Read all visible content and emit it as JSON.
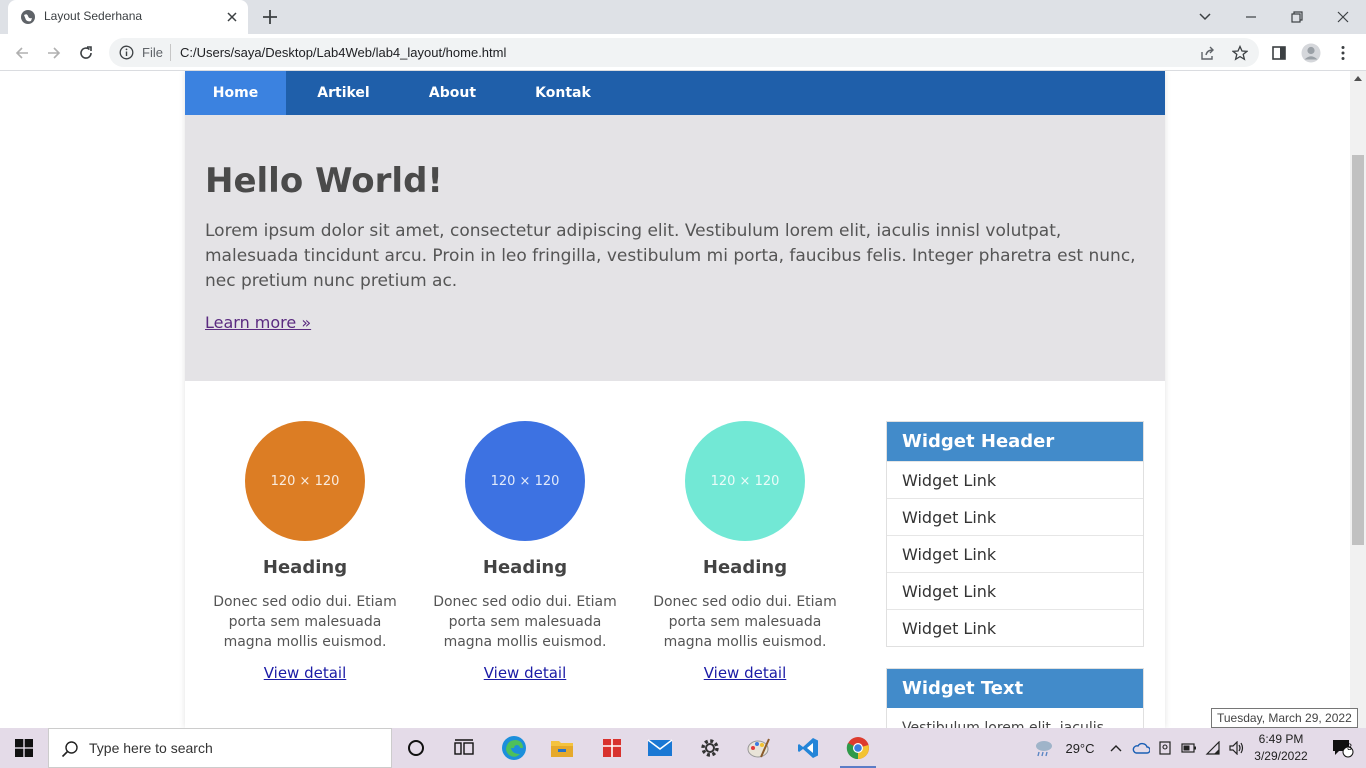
{
  "browser": {
    "tab_title": "Layout Sederhana",
    "url_scheme": "File",
    "url": "C:/Users/saya/Desktop/Lab4Web/lab4_layout/home.html"
  },
  "page": {
    "nav": {
      "items": [
        {
          "label": "Home",
          "active": true
        },
        {
          "label": "Artikel",
          "active": false
        },
        {
          "label": "About",
          "active": false
        },
        {
          "label": "Kontak",
          "active": false
        }
      ]
    },
    "hero": {
      "title": "Hello World!",
      "lead": "Lorem ipsum dolor sit amet, consectetur adipiscing elit. Vestibulum lorem elit, iaculis innisl volutpat, malesuada tincidunt arcu. Proin in leo fringilla, vestibulum mi porta, faucibus felis. Integer pharetra est nunc, nec pretium nunc pretium ac.",
      "link": "Learn more »"
    },
    "cards": [
      {
        "image_label": "120 × 120",
        "color": "#dc7d24",
        "heading": "Heading",
        "text": "Donec sed odio dui. Etiam porta sem malesuada magna mollis euismod.",
        "link": "View detail"
      },
      {
        "image_label": "120 × 120",
        "color": "#3d72e2",
        "heading": "Heading",
        "text": "Donec sed odio dui. Etiam porta sem malesuada magna mollis euismod.",
        "link": "View detail"
      },
      {
        "image_label": "120 × 120",
        "color": "#72e8d5",
        "heading": "Heading",
        "text": "Donec sed odio dui. Etiam porta sem malesuada magna mollis euismod.",
        "link": "View detail"
      }
    ],
    "widget_links": {
      "header": "Widget Header",
      "links": [
        "Widget Link",
        "Widget Link",
        "Widget Link",
        "Widget Link",
        "Widget Link"
      ]
    },
    "widget_text": {
      "header": "Widget Text",
      "body": "Vestibulum lorem elit, iaculis"
    }
  },
  "taskbar": {
    "search_placeholder": "Type here to search",
    "temperature": "29°C",
    "time": "6:49 PM",
    "date": "3/29/2022",
    "tooltip": "Tuesday, March 29, 2022",
    "notification_count": "3"
  },
  "colors": {
    "nav_bg": "#1f5faa",
    "nav_active": "#3b82e0",
    "hero_bg": "#e4e3e6",
    "widget_header": "#428bca"
  }
}
